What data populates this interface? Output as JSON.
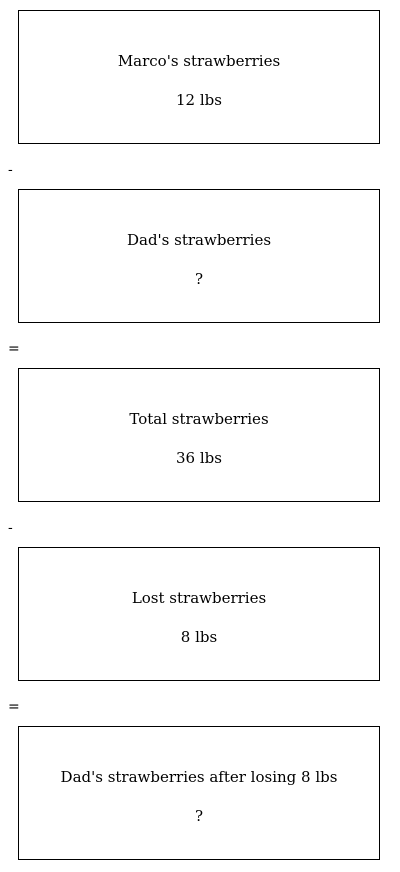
{
  "boxes": [
    {
      "label": "Marco's strawberries",
      "value": "12 lbs"
    },
    {
      "label": "Dad's strawberries",
      "value": "?"
    },
    {
      "label": "Total strawberries",
      "value": "36 lbs"
    },
    {
      "label": "Lost strawberries",
      "value": "8 lbs"
    },
    {
      "label": "Dad's strawberries after losing 8 lbs",
      "value": "?"
    }
  ],
  "operators": [
    "-",
    "=",
    "-",
    "="
  ]
}
